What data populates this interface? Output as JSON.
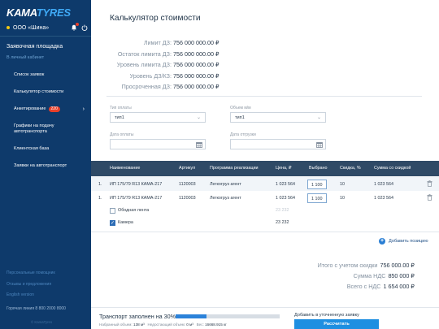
{
  "brand": {
    "kama": "KAMA",
    "tyres": "TYRES"
  },
  "org": {
    "name": "ООО «Шина»"
  },
  "sidebar": {
    "section_title": "Заявочная площадка",
    "section_sub": "В личный кабинет",
    "items": [
      {
        "label": "Список заявок"
      },
      {
        "label": "Калькулятор стоимости"
      },
      {
        "label": "Анкетирование",
        "badge": "220"
      },
      {
        "label": "Графики на подачу автотранспорта"
      },
      {
        "label": "Клиентская база"
      },
      {
        "label": "Заявки на автотранспорт"
      }
    ],
    "bottom_links": [
      "Персональные помощник",
      "Отзывы и предложения",
      "English version"
    ],
    "hotline": "Горячая линия 8 800 2000 8000",
    "copyright": "© KamaTyres"
  },
  "page": {
    "title": "Калькулятор стоимости"
  },
  "limits": [
    {
      "label": "Лимит ДЗ:",
      "value": "756 000 000.00 ₽"
    },
    {
      "label": "Остаток лимита ДЗ:",
      "value": "756 000 000.00 ₽"
    },
    {
      "label": "Уровень лимита ДЗ:",
      "value": "756 000 000.00 ₽"
    },
    {
      "label": "Уровень ДЗ/КЗ:",
      "value": "756 000 000.00 ₽"
    },
    {
      "label": "Просроченная ДЗ:",
      "value": "756 000 000.00 ₽"
    }
  ],
  "filters": {
    "payment_type": {
      "label": "Тип оплаты",
      "value": "тип1"
    },
    "volume": {
      "label": "Объем м/м",
      "value": "тип1"
    },
    "payment_date": {
      "label": "Дата оплаты",
      "value": ""
    },
    "shipment_date": {
      "label": "Дата отгрузки",
      "value": ""
    }
  },
  "table": {
    "columns": [
      "Наименование",
      "Артикул",
      "Программа реализации",
      "Цена, ₽",
      "Выбрано",
      "Скидка, %",
      "Сумма со скидкой"
    ],
    "rows": [
      {
        "num": "1.",
        "name": "ИП 175/79 R13 КАМА-217",
        "article": "1120003",
        "program": "Легкогруз агент",
        "price": "1 023 564",
        "qty": "1 100",
        "discount": "10",
        "sum": "1 023 564"
      },
      {
        "num": "1.",
        "name": "ИП 175/79 R13 КАМА-217",
        "article": "1120003",
        "program": "Легкогруз агент",
        "price": "1 023 564",
        "qty": "1 100",
        "discount": "10",
        "sum": "1 023 564"
      }
    ],
    "options": [
      {
        "label": "Ободная лента",
        "price": "23 232",
        "checked": false
      },
      {
        "label": "Камера",
        "price": "23 232",
        "checked": true
      }
    ],
    "add_position": "Добавить позицию"
  },
  "totals": [
    {
      "label": "Итого с учетом скидки",
      "value": "756 000.00 ₽"
    },
    {
      "label": "Сумма НДС",
      "value": "850 000 ₽"
    },
    {
      "label": "Всего с НДС",
      "value": "1 654 000 ₽"
    }
  ],
  "footer": {
    "transport_label": "Транспорт заполнен на 30%",
    "progress_fraction": 0.3,
    "selected_volume_label": "Набранный объем:",
    "selected_volume": "138 м³",
    "missing_volume_label": "Недостающий объем:",
    "missing_volume": "0 м³",
    "weight_label": "Вес:",
    "weight": "16668.915 кг",
    "add_request": "Добавить в уточненную заявку",
    "calc_button": "Рассчитать"
  },
  "colors": {
    "sidebar": "#0e3a6b",
    "accent": "#1e8fe1",
    "table_header": "#2f4a66",
    "badge": "#e8402a"
  }
}
